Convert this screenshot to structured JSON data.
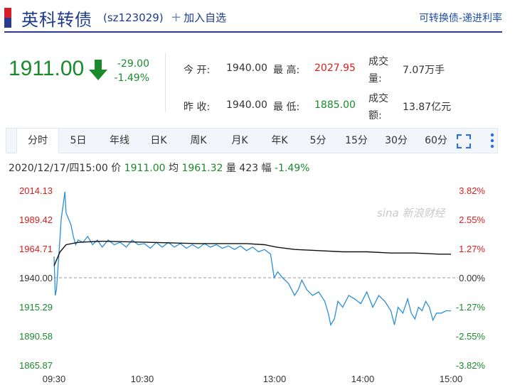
{
  "header": {
    "name": "英科转债",
    "code": "(sz123029)",
    "add_label": "加入自选",
    "right_link": "可转换债-递进利率"
  },
  "quote": {
    "price": "1911.00",
    "change": "-29.00",
    "change_pct": "-1.49%",
    "direction_icon": "down-arrow-icon",
    "open_label": "今  开:",
    "open": "1940.00",
    "high_label": "最  高:",
    "high": "2027.95",
    "volume_label_1": "成交",
    "volume_label_2": "量:",
    "volume": "7.07万手",
    "prev_close_label": "昨  收:",
    "prev_close": "1940.00",
    "low_label": "最  低:",
    "low": "1885.00",
    "amount_label_1": "成交",
    "amount_label_2": "额:",
    "amount": "13.87亿元"
  },
  "tabs": [
    {
      "label": "分时",
      "active": true
    },
    {
      "label": "5日",
      "active": false
    },
    {
      "label": "年线",
      "active": false
    },
    {
      "label": "日K",
      "active": false
    },
    {
      "label": "周K",
      "active": false
    },
    {
      "label": "月K",
      "active": false
    },
    {
      "label": "年K",
      "active": false
    },
    {
      "label": "5分",
      "active": false
    },
    {
      "label": "15分",
      "active": false
    },
    {
      "label": "30分",
      "active": false
    },
    {
      "label": "60分",
      "active": false
    }
  ],
  "infoline": {
    "datetime": "2020/12/17/四15:00",
    "price_label": "价",
    "price": "1911.00",
    "avg_label": "均",
    "avg": "1961.32",
    "vol_label": "量",
    "vol": "423",
    "range_label": "幅",
    "range": "-1.49%"
  },
  "chart_data": {
    "type": "line",
    "watermark": "新浪财经",
    "y_left_ticks": [
      "2014.13",
      "1989.42",
      "1964.71",
      "1940.00",
      "1915.29",
      "1890.58",
      "1865.87"
    ],
    "y_right_ticks": [
      "3.82%",
      "2.55%",
      "1.27%",
      "0.00%",
      "-1.27%",
      "-2.55%",
      "-3.82%"
    ],
    "x_ticks": [
      "09:30",
      "10:30",
      "13:00",
      "14:00",
      "15:00"
    ],
    "ylim": [
      1865.87,
      2014.13
    ],
    "base": 1940.0,
    "colors": {
      "price": "#2b8fd6",
      "avg": "#111111",
      "up": "#d81e1e",
      "down": "#1a8a2c",
      "zero": "#333333"
    },
    "price_series": [
      [
        0,
        1958
      ],
      [
        1,
        1925
      ],
      [
        2,
        1930
      ],
      [
        4,
        1960
      ],
      [
        6,
        1990
      ],
      [
        8,
        2005
      ],
      [
        9,
        2013
      ],
      [
        10,
        1995
      ],
      [
        12,
        1990
      ],
      [
        14,
        1985
      ],
      [
        16,
        1975
      ],
      [
        18,
        1968
      ],
      [
        20,
        1972
      ],
      [
        24,
        1970
      ],
      [
        28,
        1975
      ],
      [
        32,
        1968
      ],
      [
        36,
        1972
      ],
      [
        40,
        1966
      ],
      [
        45,
        1972
      ],
      [
        50,
        1968
      ],
      [
        55,
        1970
      ],
      [
        60,
        1966
      ],
      [
        65,
        1972
      ],
      [
        70,
        1968
      ],
      [
        75,
        1969
      ],
      [
        80,
        1965
      ],
      [
        85,
        1970
      ],
      [
        90,
        1966
      ],
      [
        95,
        1970
      ],
      [
        100,
        1966
      ],
      [
        105,
        1969
      ],
      [
        110,
        1965
      ],
      [
        115,
        1968
      ],
      [
        120,
        1965
      ],
      [
        125,
        1969
      ],
      [
        130,
        1966
      ],
      [
        135,
        1968
      ],
      [
        140,
        1965
      ],
      [
        145,
        1967
      ],
      [
        150,
        1964
      ],
      [
        155,
        1967
      ],
      [
        160,
        1963
      ],
      [
        165,
        1966
      ],
      [
        170,
        1962
      ],
      [
        175,
        1964
      ],
      [
        180,
        1960
      ],
      [
        183,
        1940
      ],
      [
        186,
        1945
      ],
      [
        190,
        1940
      ],
      [
        195,
        1935
      ],
      [
        200,
        1925
      ],
      [
        203,
        1930
      ],
      [
        206,
        1938
      ],
      [
        210,
        1930
      ],
      [
        215,
        1925
      ],
      [
        220,
        1928
      ],
      [
        225,
        1920
      ],
      [
        228,
        1910
      ],
      [
        230,
        1900
      ],
      [
        233,
        1905
      ],
      [
        236,
        1920
      ],
      [
        240,
        1915
      ],
      [
        245,
        1925
      ],
      [
        250,
        1922
      ],
      [
        255,
        1918
      ],
      [
        260,
        1928
      ],
      [
        265,
        1915
      ],
      [
        270,
        1925
      ],
      [
        275,
        1920
      ],
      [
        280,
        1912
      ],
      [
        283,
        1900
      ],
      [
        286,
        1915
      ],
      [
        290,
        1910
      ],
      [
        294,
        1922
      ],
      [
        297,
        1910
      ],
      [
        300,
        1905
      ],
      [
        303,
        1915
      ],
      [
        306,
        1912
      ],
      [
        309,
        1920
      ],
      [
        312,
        1915
      ],
      [
        315,
        1904
      ],
      [
        318,
        1910
      ],
      [
        322,
        1910
      ],
      [
        326,
        1912
      ],
      [
        330,
        1912
      ]
    ],
    "avg_series": [
      [
        0,
        1950
      ],
      [
        2,
        1955
      ],
      [
        5,
        1962
      ],
      [
        10,
        1968
      ],
      [
        20,
        1970
      ],
      [
        40,
        1971
      ],
      [
        80,
        1970
      ],
      [
        120,
        1969
      ],
      [
        160,
        1969
      ],
      [
        175,
        1968
      ],
      [
        185,
        1966
      ],
      [
        200,
        1964
      ],
      [
        220,
        1963
      ],
      [
        240,
        1962
      ],
      [
        260,
        1962
      ],
      [
        280,
        1961
      ],
      [
        300,
        1961
      ],
      [
        320,
        1960
      ],
      [
        330,
        1960
      ]
    ]
  }
}
